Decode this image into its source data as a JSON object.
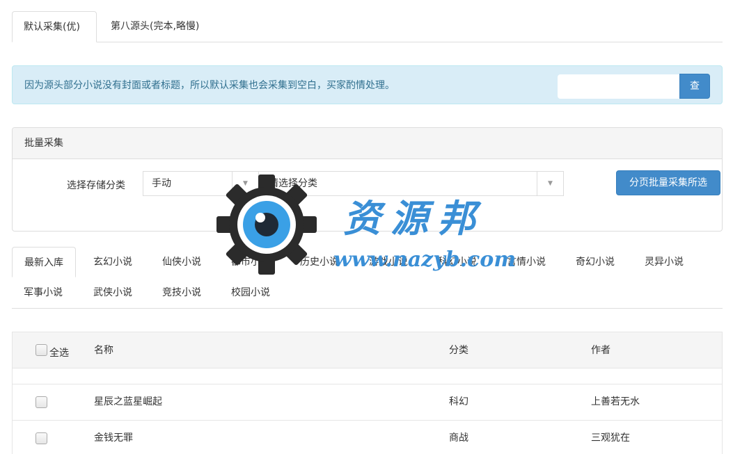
{
  "top_tabs": [
    "默认采集(优)",
    "第八源头(完本,略慢)"
  ],
  "alert": {
    "text": "因为源头部分小说没有封面或者标题，所以默认采集也会采集到空白，买家酌情处理。",
    "search_value": "",
    "search_button": "查"
  },
  "batch": {
    "heading": "批量采集",
    "label": "选择存储分类",
    "mode_value": "手动",
    "category_placeholder": "请选择分类",
    "submit_button": "分页批量采集所选"
  },
  "category_tabs": [
    "最新入库",
    "玄幻小说",
    "仙侠小说",
    "都市小说",
    "历史小说",
    "游戏小说",
    "科幻小说",
    "言情小说",
    "奇幻小说",
    "灵异小说",
    "军事小说",
    "武侠小说",
    "竞技小说",
    "校园小说"
  ],
  "table": {
    "headers": {
      "select_all": "全选",
      "name": "名称",
      "category": "分类",
      "author": "作者"
    },
    "rows": [
      {
        "name": "星辰之蓝星崛起",
        "category": "科幻",
        "author": "上善若无水"
      },
      {
        "name": "金钱无罪",
        "category": "商战",
        "author": "三观犹在"
      }
    ]
  },
  "watermark": {
    "text": "资源邦",
    "url": "www.nazyb.com"
  },
  "colors": {
    "primary": "#428bca",
    "alert_bg": "#d9edf7",
    "alert_text": "#31708f",
    "watermark": "#3a8fd6"
  }
}
